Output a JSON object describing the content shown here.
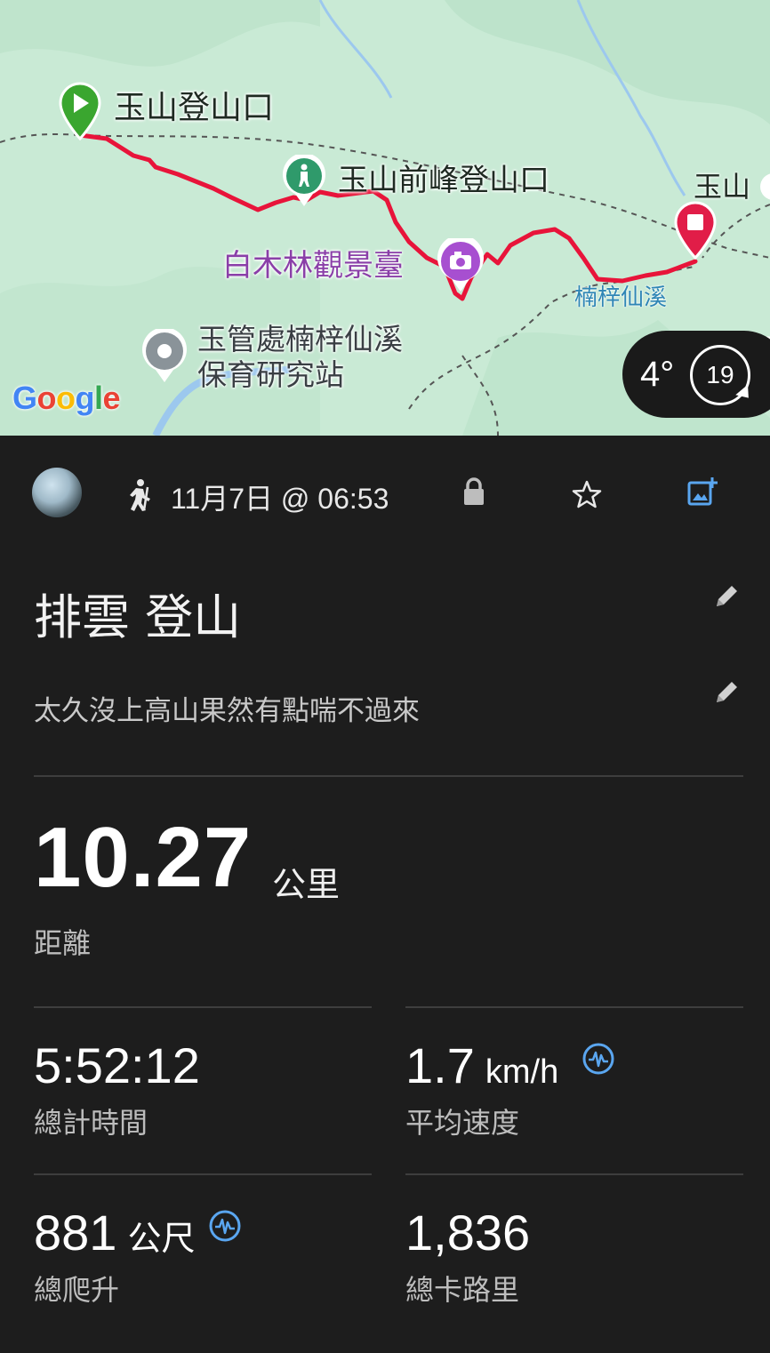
{
  "map": {
    "labels": {
      "trailhead": "玉山登山口",
      "peak_trailhead": "玉山前峰登山口",
      "yushan": "玉山",
      "viewpoint": "白木林觀景臺",
      "creek": "楠梓仙溪",
      "station": "玉管處楠梓仙溪保育研究站"
    },
    "google_logo": "Google",
    "weather": {
      "temp": "4°",
      "wind": "19"
    },
    "colors": {
      "route": "#e8143a",
      "start_pin": "#3aa62f",
      "end_pin": "#e11d48",
      "poi_purple": "#a74fd0",
      "poi_green": "#2f9a6b"
    }
  },
  "activity": {
    "activity_type_icon": "hiking-icon",
    "date": "11月7日 @ 06:53",
    "title": "排雲 登山",
    "description": "太久沒上高山果然有點喘不過來",
    "distance": {
      "value": "10.27",
      "unit": "公里",
      "label": "距離"
    },
    "stats": [
      {
        "value": "5:52:12",
        "unit": "",
        "label": "總計時間"
      },
      {
        "value": "1.7",
        "unit": "km/h",
        "label": "平均速度"
      },
      {
        "value": "881",
        "unit": "公尺",
        "label": "總爬升"
      },
      {
        "value": "1,836",
        "unit": "",
        "label": "總卡路里"
      }
    ],
    "accent_color": "#5aa6f0"
  }
}
